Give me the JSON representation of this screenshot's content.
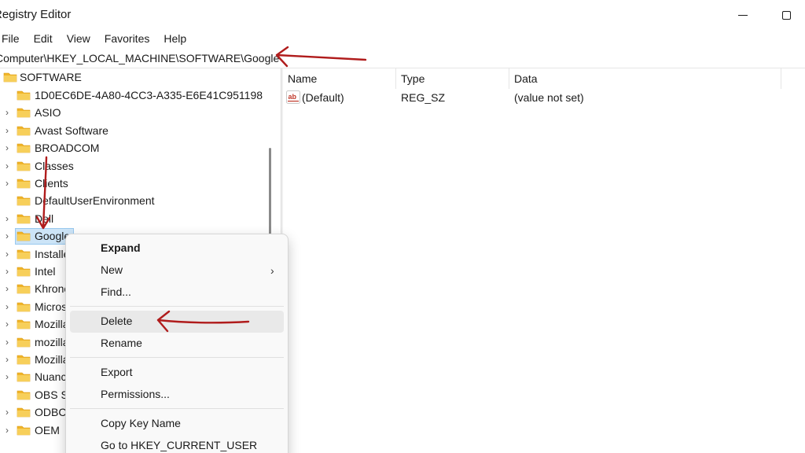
{
  "window": {
    "title": "Registry Editor"
  },
  "menu": [
    "File",
    "Edit",
    "View",
    "Favorites",
    "Help"
  ],
  "address": "Computer\\HKEY_LOCAL_MACHINE\\SOFTWARE\\Google",
  "tree": {
    "root": "SOFTWARE",
    "items": [
      {
        "label": "1D0EC6DE-4A80-4CC3-A335-E6E41C951198",
        "expandable": false
      },
      {
        "label": "ASIO",
        "expandable": true
      },
      {
        "label": "Avast Software",
        "expandable": true
      },
      {
        "label": "BROADCOM",
        "expandable": true
      },
      {
        "label": "Classes",
        "expandable": true
      },
      {
        "label": "Clients",
        "expandable": true
      },
      {
        "label": "DefaultUserEnvironment",
        "expandable": false
      },
      {
        "label": "Dell",
        "expandable": true
      },
      {
        "label": "Google",
        "expandable": true,
        "selected": true
      },
      {
        "label": "Installer",
        "expandable": true
      },
      {
        "label": "Intel",
        "expandable": true
      },
      {
        "label": "Khronos",
        "expandable": true
      },
      {
        "label": "Microsoft",
        "expandable": true
      },
      {
        "label": "Mozilla",
        "expandable": true
      },
      {
        "label": "mozilla.org",
        "expandable": true
      },
      {
        "label": "MozillaPlugins",
        "expandable": true
      },
      {
        "label": "Nuance",
        "expandable": true
      },
      {
        "label": "OBS Studio",
        "expandable": false
      },
      {
        "label": "ODBC",
        "expandable": true
      },
      {
        "label": "OEM",
        "expandable": true
      }
    ]
  },
  "list": {
    "columns": [
      "Name",
      "Type",
      "Data"
    ],
    "rows": [
      {
        "name": "(Default)",
        "type": "REG_SZ",
        "data": "(value not set)",
        "icon": "ab-string-icon"
      }
    ]
  },
  "context_menu": {
    "items": [
      {
        "label": "Expand",
        "bold": true
      },
      {
        "label": "New",
        "submenu": true
      },
      {
        "label": "Find..."
      },
      {
        "separator": true
      },
      {
        "label": "Delete",
        "hover": true
      },
      {
        "label": "Rename"
      },
      {
        "separator": true
      },
      {
        "label": "Export"
      },
      {
        "label": "Permissions..."
      },
      {
        "separator": true
      },
      {
        "label": "Copy Key Name"
      },
      {
        "label": "Go to HKEY_CURRENT_USER"
      }
    ]
  },
  "colors": {
    "annotation_arrow": "#b01c1c",
    "folder": "#f5c542",
    "selection": "#cce4f7"
  }
}
